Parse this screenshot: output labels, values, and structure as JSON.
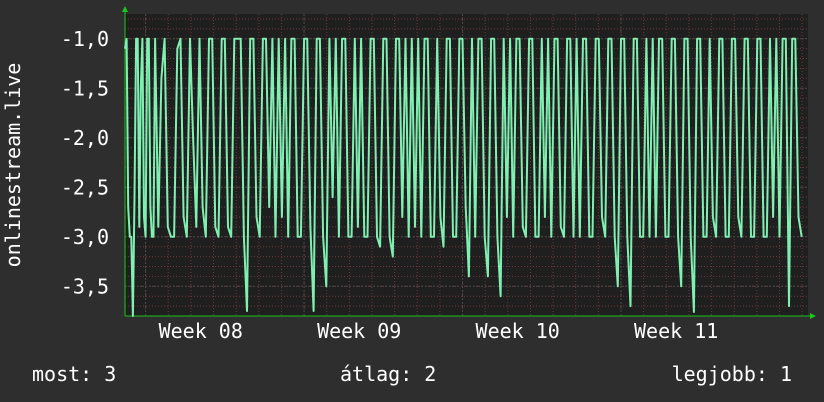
{
  "chart_data": {
    "type": "line",
    "ylabel": "onlinestream.live",
    "y_ticks": [
      "-1,0",
      "-1,5",
      "-2,0",
      "-2,5",
      "-3,0",
      "-3,5"
    ],
    "y_tick_values": [
      -1.0,
      -1.5,
      -2.0,
      -2.5,
      -3.0,
      -3.5
    ],
    "ylim": [
      -3.8,
      -0.75
    ],
    "x_ticks": [
      "Week 08",
      "Week 09",
      "Week 10",
      "Week 11"
    ],
    "xlim_weeks": [
      7.87,
      12.18
    ],
    "grid": true,
    "series": [
      {
        "color": "#7ff0b2",
        "x_weeks": [
          7.87,
          7.88,
          7.89,
          7.9,
          7.91,
          7.92,
          7.93,
          7.94,
          7.95,
          7.96,
          7.97,
          7.98,
          7.99,
          8.0,
          8.01,
          8.02,
          8.03,
          8.04,
          8.05,
          8.06,
          8.08,
          8.1,
          8.12,
          8.14,
          8.16,
          8.18,
          8.2,
          8.22,
          8.24,
          8.26,
          8.28,
          8.3,
          8.32,
          8.34,
          8.36,
          8.38,
          8.4,
          8.42,
          8.44,
          8.46,
          8.48,
          8.5,
          8.52,
          8.54,
          8.56,
          8.58,
          8.6,
          8.62,
          8.64,
          8.66,
          8.68,
          8.7,
          8.72,
          8.74,
          8.76,
          8.78,
          8.8,
          8.82,
          8.84,
          8.86,
          8.88,
          8.9,
          8.92,
          8.94,
          8.96,
          8.98,
          9.0,
          9.02,
          9.04,
          9.06,
          9.08,
          9.1,
          9.12,
          9.14,
          9.16,
          9.18,
          9.2,
          9.22,
          9.24,
          9.26,
          9.28,
          9.3,
          9.32,
          9.34,
          9.36,
          9.38,
          9.4,
          9.42,
          9.44,
          9.46,
          9.48,
          9.5,
          9.52,
          9.54,
          9.56,
          9.58,
          9.6,
          9.62,
          9.64,
          9.66,
          9.68,
          9.7,
          9.72,
          9.74,
          9.76,
          9.78,
          9.8,
          9.82,
          9.84,
          9.86,
          9.88,
          9.9,
          9.92,
          9.94,
          9.96,
          9.98,
          10.0,
          10.02,
          10.04,
          10.06,
          10.08,
          10.1,
          10.12,
          10.14,
          10.16,
          10.18,
          10.2,
          10.22,
          10.24,
          10.26,
          10.28,
          10.3,
          10.32,
          10.34,
          10.36,
          10.38,
          10.4,
          10.42,
          10.44,
          10.46,
          10.48,
          10.5,
          10.52,
          10.54,
          10.56,
          10.58,
          10.6,
          10.62,
          10.64,
          10.66,
          10.68,
          10.7,
          10.72,
          10.74,
          10.76,
          10.78,
          10.8,
          10.82,
          10.84,
          10.86,
          10.88,
          10.9,
          10.92,
          10.94,
          10.96,
          10.98,
          11.0,
          11.02,
          11.04,
          11.06,
          11.08,
          11.1,
          11.12,
          11.14,
          11.16,
          11.18,
          11.2,
          11.22,
          11.24,
          11.26,
          11.28,
          11.3,
          11.32,
          11.34,
          11.36,
          11.38,
          11.4,
          11.42,
          11.44,
          11.46,
          11.48,
          11.5,
          11.52,
          11.54,
          11.56,
          11.58,
          11.6,
          11.62,
          11.64,
          11.66,
          11.68,
          11.7,
          11.72,
          11.74,
          11.76,
          11.78,
          11.8,
          11.82,
          11.84,
          11.86,
          11.88,
          11.9,
          11.92,
          11.94,
          11.96,
          11.98,
          12.0,
          12.02,
          12.04,
          12.06,
          12.08,
          12.1,
          12.12,
          12.14,
          12.16,
          12.18
        ],
        "values": [
          -1.1,
          -1.0,
          -2.7,
          -3.0,
          -3.0,
          -3.8,
          -2.6,
          -1.0,
          -1.0,
          -2.9,
          -1.5,
          -1.0,
          -2.8,
          -3.0,
          -1.0,
          -1.0,
          -2.7,
          -3.0,
          -3.0,
          -1.0,
          -2.9,
          -1.4,
          -1.0,
          -2.9,
          -3.0,
          -3.0,
          -1.1,
          -1.0,
          -2.8,
          -3.0,
          -1.0,
          -2.0,
          -2.9,
          -1.0,
          -2.7,
          -3.0,
          -1.0,
          -1.0,
          -2.9,
          -3.0,
          -1.0,
          -1.0,
          -2.9,
          -3.0,
          -1.0,
          -1.0,
          -1.0,
          -3.0,
          -3.75,
          -1.0,
          -1.0,
          -2.8,
          -3.0,
          -1.0,
          -1.0,
          -2.7,
          -1.0,
          -3.0,
          -1.0,
          -2.8,
          -1.0,
          -3.0,
          -1.0,
          -1.0,
          -3.0,
          -3.0,
          -1.0,
          -1.0,
          -2.9,
          -3.75,
          -1.0,
          -1.0,
          -3.0,
          -3.5,
          -1.0,
          -2.6,
          -1.0,
          -3.0,
          -1.0,
          -1.0,
          -3.0,
          -3.0,
          -1.0,
          -2.9,
          -1.0,
          -3.0,
          -3.0,
          -1.0,
          -1.0,
          -3.0,
          -3.1,
          -1.0,
          -1.0,
          -3.0,
          -3.2,
          -1.0,
          -1.0,
          -2.8,
          -1.0,
          -3.0,
          -1.0,
          -2.9,
          -1.0,
          -3.0,
          -1.0,
          -1.0,
          -3.0,
          -3.0,
          -1.0,
          -2.8,
          -3.1,
          -1.0,
          -1.0,
          -3.0,
          -3.0,
          -1.0,
          -1.0,
          -2.7,
          -3.4,
          -1.0,
          -3.0,
          -1.0,
          -1.0,
          -3.0,
          -3.4,
          -1.0,
          -1.0,
          -3.0,
          -3.6,
          -1.0,
          -2.8,
          -1.0,
          -3.0,
          -1.0,
          -1.0,
          -2.9,
          -3.0,
          -1.0,
          -1.0,
          -3.0,
          -3.0,
          -1.0,
          -2.8,
          -1.0,
          -3.0,
          -1.0,
          -1.0,
          -2.9,
          -3.0,
          -1.0,
          -1.0,
          -3.0,
          -1.0,
          -3.0,
          -1.0,
          -1.0,
          -3.0,
          -3.0,
          -1.0,
          -1.0,
          -2.8,
          -3.0,
          -1.0,
          -1.0,
          -3.0,
          -3.5,
          -1.0,
          -1.0,
          -3.0,
          -3.7,
          -1.0,
          -1.0,
          -3.0,
          -3.0,
          -1.0,
          -3.0,
          -1.0,
          -3.0,
          -1.0,
          -1.0,
          -3.0,
          -3.0,
          -1.0,
          -1.0,
          -3.0,
          -3.5,
          -1.0,
          -1.0,
          -3.0,
          -3.76,
          -1.0,
          -1.0,
          -3.0,
          -3.0,
          -1.0,
          -2.8,
          -3.0,
          -1.0,
          -1.0,
          -3.0,
          -3.0,
          -1.0,
          -1.0,
          -2.8,
          -3.0,
          -1.0,
          -1.0,
          -3.0,
          -3.0,
          -1.0,
          -1.0,
          -3.0,
          -3.0,
          -1.0,
          -2.8,
          -1.0,
          -3.0,
          -1.0,
          -1.0,
          -3.7,
          -1.0,
          -1.0,
          -2.8,
          -3.0
        ]
      }
    ]
  },
  "legend": {
    "current": "most: 3",
    "average": "átlag: 2",
    "best": "legjobb: 1"
  },
  "colors": {
    "background": "#2e2e2e",
    "plot_background": "#1f1f1f",
    "grid_major": "#4a4a4a",
    "grid_minor": "#6a3a3a",
    "axis_arrow": "#19c519",
    "series": "#7ff0b2",
    "text": "#ffffff"
  }
}
